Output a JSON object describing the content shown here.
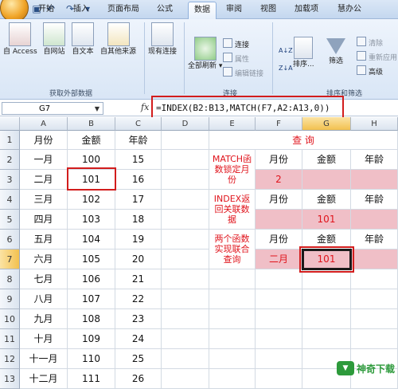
{
  "tabs": [
    "开始",
    "插入",
    "页面布局",
    "公式",
    "数据",
    "审阅",
    "视图",
    "加载项",
    "慧办公"
  ],
  "active_tab": "数据",
  "ribbon": {
    "groups": {
      "external": "获取外部数据",
      "connections": "连接",
      "sort_filter": "排序和筛选"
    },
    "big_buttons": [
      "自 Access",
      "自网站",
      "自文本",
      "自其他来源",
      "现有连接",
      "全部刷新",
      "筛选"
    ],
    "refresh_dropdown": "▾",
    "sort_label": "排序...",
    "connections_small": [
      "连接",
      "属性",
      "编辑链接"
    ],
    "filter_small": [
      "清除",
      "重新应用",
      "高级"
    ],
    "sort_icons": [
      "A↓Z",
      "Z↓A"
    ]
  },
  "formula_bar": {
    "name_box": "G7",
    "fx": "fx",
    "formula": "=INDEX(B2:B13,MATCH(F7,A2:A13,0))"
  },
  "columns": [
    "A",
    "B",
    "C",
    "D",
    "E",
    "F",
    "G",
    "H"
  ],
  "rows": [
    "1",
    "2",
    "3",
    "4",
    "5",
    "6",
    "7",
    "8",
    "9",
    "10",
    "11",
    "12",
    "13"
  ],
  "table_left": [
    [
      "月份",
      "金额",
      "年龄"
    ],
    [
      "一月",
      "100",
      "15"
    ],
    [
      "二月",
      "101",
      "16"
    ],
    [
      "三月",
      "102",
      "17"
    ],
    [
      "四月",
      "103",
      "18"
    ],
    [
      "五月",
      "104",
      "19"
    ],
    [
      "六月",
      "105",
      "20"
    ],
    [
      "七月",
      "106",
      "21"
    ],
    [
      "八月",
      "107",
      "22"
    ],
    [
      "九月",
      "108",
      "23"
    ],
    [
      "十月",
      "109",
      "24"
    ],
    [
      "十一月",
      "110",
      "25"
    ],
    [
      "十二月",
      "111",
      "26"
    ]
  ],
  "query": {
    "title": "查 询",
    "match_desc": "MATCH函数锁定月份",
    "index_desc": "INDEX返回关联数据",
    "combo_desc": "两个函数实现联合查询",
    "headers": [
      "月份",
      "金额",
      "年龄"
    ],
    "match_result": "2",
    "index_result": "101",
    "combo_month": "二月",
    "combo_result": "101"
  },
  "watermark": "神奇下载",
  "colors": {
    "pink": "#f0bfc7",
    "red_text": "#e0141c",
    "highlight": "#d21d1d"
  }
}
